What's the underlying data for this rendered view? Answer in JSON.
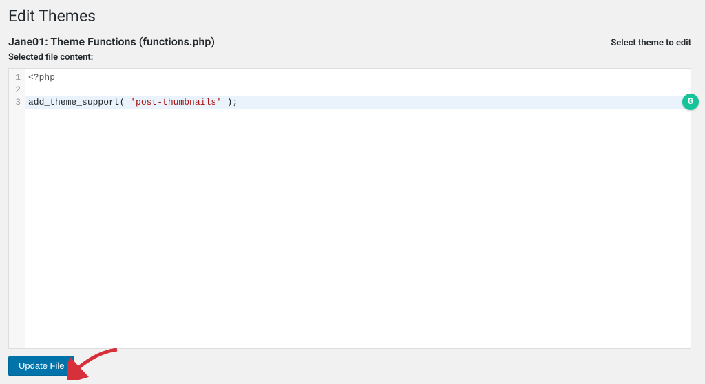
{
  "page": {
    "title": "Edit Themes",
    "file_heading": "Jane01: Theme Functions (functions.php)",
    "select_theme_label": "Select theme to edit",
    "content_label": "Selected file content:",
    "update_button_label": "Update File"
  },
  "editor": {
    "lines": [
      {
        "n": "1",
        "segments": [
          {
            "text": "<?php",
            "cls": "tok-meta"
          }
        ]
      },
      {
        "n": "2",
        "segments": []
      },
      {
        "n": "3",
        "active": true,
        "segments": [
          {
            "text": "add_theme_support( ",
            "cls": "tok-func"
          },
          {
            "text": "'post-thumbnails'",
            "cls": "tok-string"
          },
          {
            "text": " );",
            "cls": "tok-func"
          }
        ]
      }
    ]
  },
  "badge": {
    "letter": "G"
  }
}
